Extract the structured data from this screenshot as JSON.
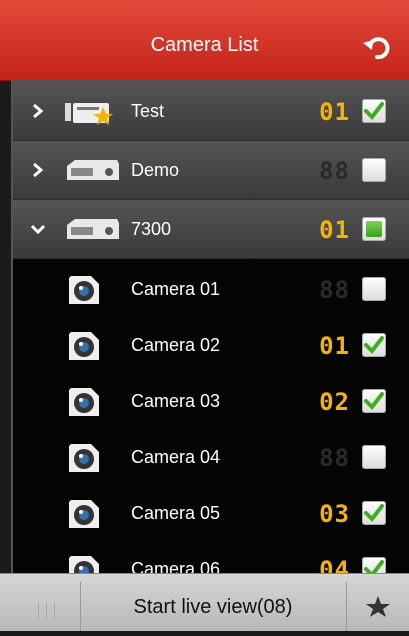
{
  "header": {
    "title": "Camera List",
    "refresh_icon": "refresh-icon"
  },
  "groups": [
    {
      "name": "Test",
      "expanded": false,
      "display_number": "01",
      "checked": "checked",
      "icon": "nvr-favorite-icon"
    },
    {
      "name": "Demo",
      "expanded": false,
      "display_number": "88",
      "checked": "unchecked",
      "icon": "dvr-device-icon"
    },
    {
      "name": "7300",
      "expanded": true,
      "display_number": "01",
      "checked": "partial",
      "icon": "dvr-device-icon"
    }
  ],
  "cameras": [
    {
      "name": "Camera 01",
      "display_number": "88",
      "checked": "unchecked"
    },
    {
      "name": "Camera 02",
      "display_number": "01",
      "checked": "checked"
    },
    {
      "name": "Camera 03",
      "display_number": "02",
      "checked": "checked"
    },
    {
      "name": "Camera 04",
      "display_number": "88",
      "checked": "unchecked"
    },
    {
      "name": "Camera 05",
      "display_number": "03",
      "checked": "checked"
    },
    {
      "name": "Camera 06",
      "display_number": "04",
      "checked": "checked"
    }
  ],
  "footer": {
    "start_live_label": "Start live view(08)",
    "favorite_icon": "star-icon",
    "grip_icon": "grip-icon"
  },
  "colors": {
    "header": "#d83a2c",
    "digits": "#f6b400",
    "check": "#3fae1e"
  }
}
